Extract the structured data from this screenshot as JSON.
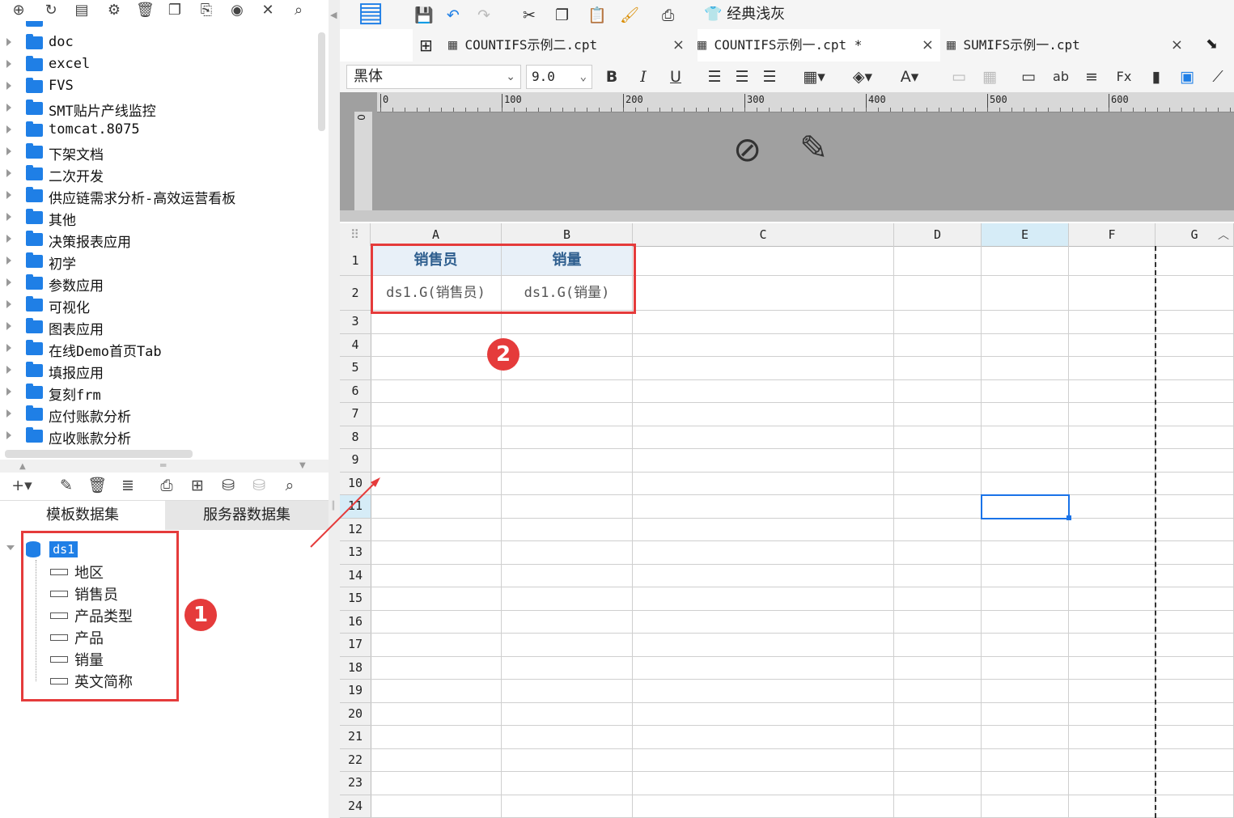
{
  "left_toolbar_icons": [
    "new-template-icon",
    "refresh-icon",
    "open-icon",
    "settings-icon",
    "delete-icon",
    "copy-icon",
    "paste-icon",
    "locate-icon",
    "collapse-icon",
    "search-icon"
  ],
  "tree_items": [
    "doc",
    "excel",
    "FVS",
    "SMT贴片产线监控",
    "tomcat.8075",
    "下架文档",
    "二次开发",
    "供应链需求分析-高效运营看板",
    "其他",
    "决策报表应用",
    "初学",
    "参数应用",
    "可视化",
    "图表应用",
    "在线Demo首页Tab",
    "填报应用",
    "复刻frm",
    "应付账款分析",
    "应收账款分析"
  ],
  "dataset_tabs": {
    "template": "模板数据集",
    "server": "服务器数据集"
  },
  "dataset": {
    "name": "ds1",
    "fields": [
      "地区",
      "销售员",
      "产品类型",
      "产品",
      "销量",
      "英文简称"
    ]
  },
  "badges": {
    "one": "1",
    "two": "2"
  },
  "ribbon": {
    "theme_label": "经典浅灰"
  },
  "tabs": [
    {
      "label": "COUNTIFS示例二.cpt",
      "close": "×"
    },
    {
      "label": "COUNTIFS示例一.cpt *",
      "close": "×"
    },
    {
      "label": "SUMIFS示例一.cpt",
      "close": "×"
    }
  ],
  "format": {
    "font": "黑体",
    "size": "9.0",
    "bold": "B",
    "italic": "I",
    "underline": "U"
  },
  "ruler_ticks": [
    "0",
    "100",
    "200",
    "300",
    "400",
    "500",
    "600"
  ],
  "vruler_label": "0",
  "columns": [
    "A",
    "B",
    "C",
    "D",
    "E",
    "F",
    "G"
  ],
  "rows": [
    "1",
    "2",
    "3",
    "4",
    "5",
    "6",
    "7",
    "8",
    "9",
    "10",
    "11",
    "12",
    "13",
    "14",
    "15",
    "16",
    "17",
    "18",
    "19",
    "20",
    "21",
    "22",
    "23",
    "24"
  ],
  "cells": {
    "A1": "销售员",
    "B1": "销量",
    "A2": "ds1.G(销售员)",
    "B2": "ds1.G(销量)"
  },
  "colors": {
    "accent": "#1f7fe6",
    "highlight": "#e53b3b",
    "selection": "#1a73e8"
  }
}
